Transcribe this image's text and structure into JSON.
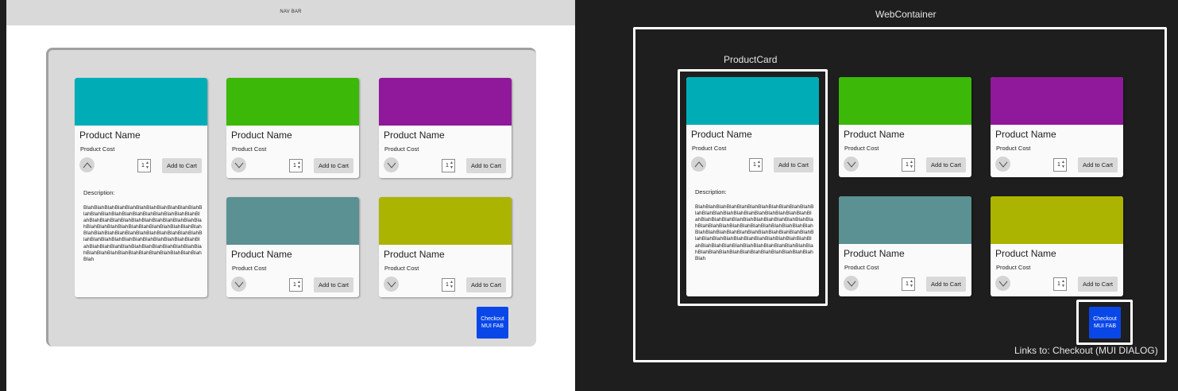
{
  "navbar": {
    "label": "NAV BAR"
  },
  "product": {
    "name": "Product Name",
    "cost": "Product Cost",
    "qty": "1",
    "add_label": "Add to Cart",
    "description_label": "Description:",
    "description_text": "BlahBlahBlahBlahBlahBlahBlahBlahBlahBlahBlahBlahBlahBlahBlahBlahBlahBlahBlahBlahBlahBlahBlahBlahBlahBlahBlahBlahBlahBlahBlahBlahBlahBlahBlahBlahBlahBlahBlahBlahBlahBlahBlahBlahBlahBlahBlahBlahBlahBlahBlahBlahBlahBlahBlahBlahBlahBlahBlahBlahBlahBlahBlahBlahBlahBlahBlahBlahBlahBlahBlahBlahBlahBlahBlahBlahBlahBlahBlahBlahBlahBlahBlahBlahBlahBlahBlahBlahBlahBlahBlah"
  },
  "card_colors": {
    "teal": "#00adb7",
    "green": "#3cb808",
    "purple": "#90189b",
    "slate": "#5b9193",
    "olive": "#abb400"
  },
  "fab": {
    "line1": "Checkout",
    "line2": "MUI FAB"
  },
  "annotations": {
    "web_container": "WebContainer",
    "product_card": "ProductCard",
    "links_to": "Links to: Checkout (MUI DIALOG)"
  }
}
